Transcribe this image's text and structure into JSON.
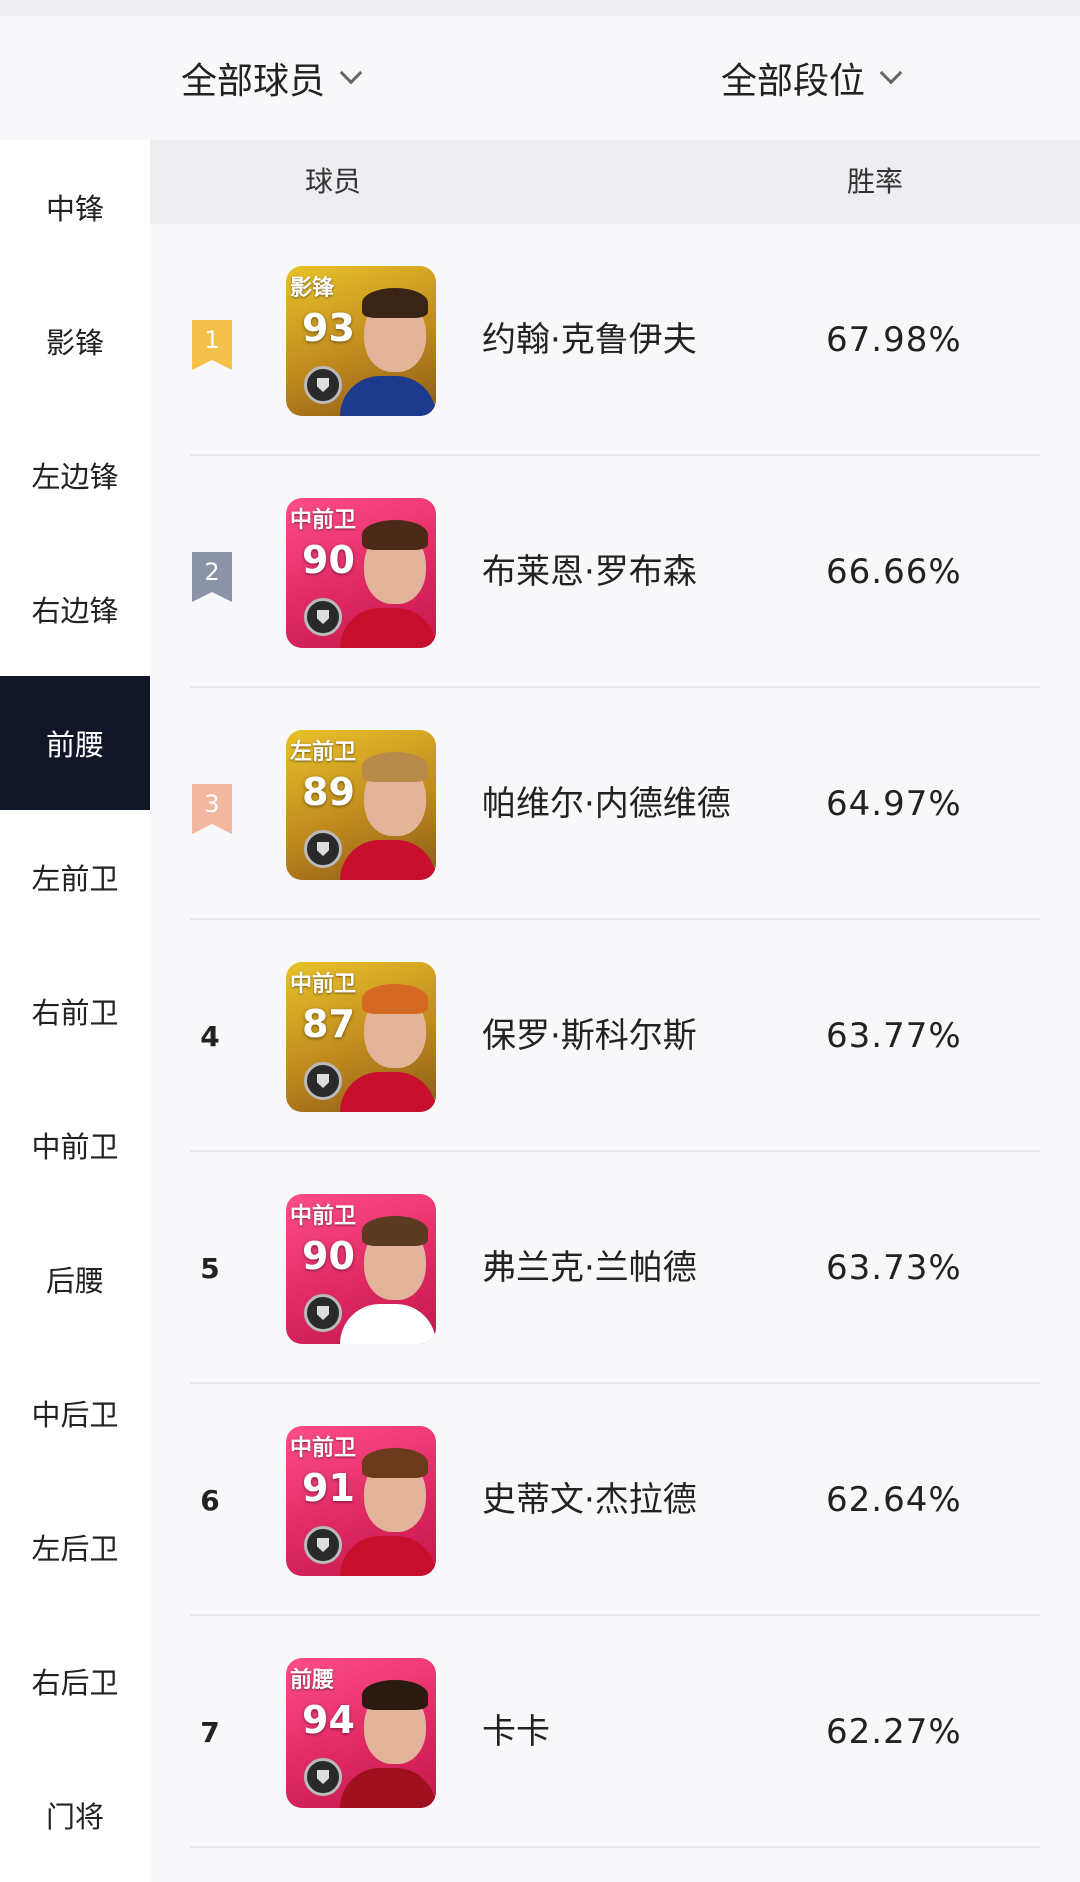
{
  "filters": {
    "players": "全部球员",
    "tiers": "全部段位"
  },
  "sidebar": {
    "items": [
      "中锋",
      "影锋",
      "左边锋",
      "右边锋",
      "前腰",
      "左前卫",
      "右前卫",
      "中前卫",
      "后腰",
      "中后卫",
      "左后卫",
      "右后卫",
      "门将"
    ],
    "active_index": 4
  },
  "table": {
    "header_player": "球员",
    "header_rate": "胜率",
    "rows": [
      {
        "rank": "1",
        "position": "影锋",
        "rating": "93",
        "name": "约翰·克鲁伊夫",
        "rate": "67.98%",
        "card_theme": "gold",
        "shirt": "#1d3b8c",
        "hair": "#3a2414"
      },
      {
        "rank": "2",
        "position": "中前卫",
        "rating": "90",
        "name": "布莱恩·罗布森",
        "rate": "66.66%",
        "card_theme": "pink",
        "shirt": "#c8102e",
        "hair": "#4a2a16"
      },
      {
        "rank": "3",
        "position": "左前卫",
        "rating": "89",
        "name": "帕维尔·内德维德",
        "rate": "64.97%",
        "card_theme": "gold",
        "shirt": "#c8102e",
        "hair": "#b88a4a"
      },
      {
        "rank": "4",
        "position": "中前卫",
        "rating": "87",
        "name": "保罗·斯科尔斯",
        "rate": "63.77%",
        "card_theme": "gold",
        "shirt": "#c8102e",
        "hair": "#d46a22"
      },
      {
        "rank": "5",
        "position": "中前卫",
        "rating": "90",
        "name": "弗兰克·兰帕德",
        "rate": "63.73%",
        "card_theme": "pink",
        "shirt": "#ffffff",
        "hair": "#5a3a20"
      },
      {
        "rank": "6",
        "position": "中前卫",
        "rating": "91",
        "name": "史蒂文·杰拉德",
        "rate": "62.64%",
        "card_theme": "pink",
        "shirt": "#c8102e",
        "hair": "#6a3a1a"
      },
      {
        "rank": "7",
        "position": "前腰",
        "rating": "94",
        "name": "卡卡",
        "rate": "62.27%",
        "card_theme": "pink",
        "shirt": "#a0101e",
        "hair": "#2a1a10"
      }
    ]
  },
  "colors": {
    "active_bg": "#111628",
    "ribbon_gold": "#f5c04a",
    "ribbon_silver": "#8b93a8",
    "ribbon_bronze": "#f2b8a0",
    "card_gold_top": "#e8c22a",
    "card_gold_bottom": "#8a5a18",
    "card_pink_top": "#ff4d8a",
    "card_pink_bottom": "#c2184a"
  }
}
